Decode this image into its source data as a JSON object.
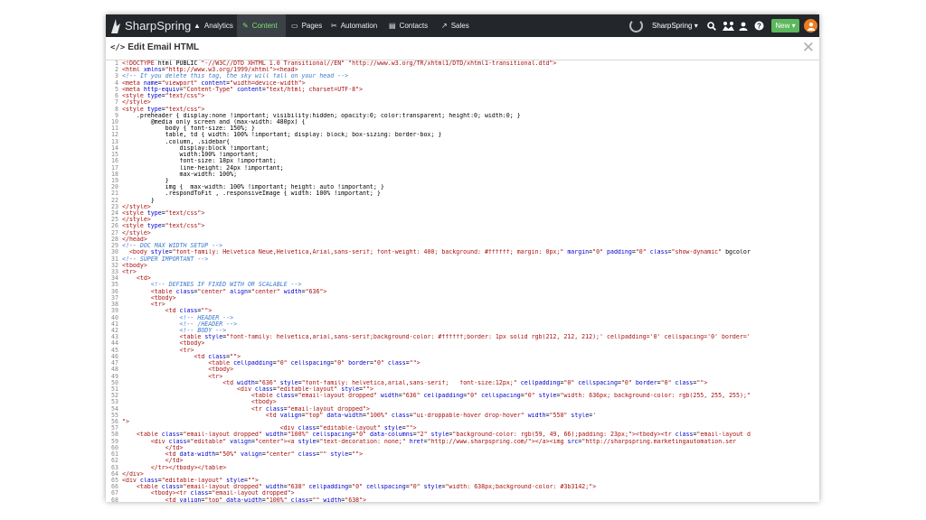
{
  "app": {
    "name": "SharpSpring"
  },
  "nav": {
    "items": [
      {
        "label": "Analytics",
        "icon": "analytics-icon",
        "glyph": "▲",
        "active": false
      },
      {
        "label": "Content",
        "icon": "pencil-icon",
        "glyph": "✎",
        "active": true
      },
      {
        "label": "Pages",
        "icon": "page-icon",
        "glyph": "▭",
        "active": false
      },
      {
        "label": "Automation",
        "icon": "automation-icon",
        "glyph": "✂",
        "active": false
      },
      {
        "label": "Contacts",
        "icon": "contacts-icon",
        "glyph": "▤",
        "active": false
      },
      {
        "label": "Sales",
        "icon": "sales-icon",
        "glyph": "↗",
        "active": false
      }
    ],
    "account_label": "SharpSpring ▾",
    "new_label": "New ▾",
    "right_icons": [
      "spinner-icon",
      "search-icon",
      "apps-icon",
      "user-icon",
      "help-icon",
      "avatar-icon"
    ]
  },
  "colors": {
    "topbar": "#23262b",
    "active_nav": "#3c4047",
    "active_text": "#7ee06e",
    "new_button": "#5cb85c",
    "avatar": "#f07c1e"
  },
  "header": {
    "title": "Edit Email HTML",
    "title_icon": "code-icon",
    "close_label": "✕",
    "close_icon": "close-icon"
  },
  "editor": {
    "lines": [
      "<!DOCTYPE html PUBLIC \"-//W3C//DTD XHTML 1.0 Transitional//EN\" \"http://www.w3.org/TR/xhtml1/DTD/xhtml1-transitional.dtd\">",
      "<html xmlns=\"http://www.w3.org/1999/xhtml\"><head>",
      "<!-- If you delete this tag, the sky will fall on your head -->",
      "<meta name=\"viewport\" content=\"width=device-width\">",
      "<meta http-equiv=\"Content-Type\" content=\"text/html; charset=UTF-8\">",
      "<style type=\"text/css\">",
      "</style>",
      "<style type=\"text/css\">",
      "    .preheader { display:none !important; visibility:hidden; opacity:0; color:transparent; height:0; width:0; }",
      "        @media only screen and (max-width: 480px) {",
      "            body { font-size: 150%; }",
      "            table, td { width: 100% !important; display: block; box-sizing: border-box; }",
      "            .column, .sidebar{",
      "                display:block !important;",
      "                width:100% !important;",
      "                font-size: 18px !important;",
      "                line-height: 24px !important;",
      "                max-width: 100%;",
      "            }",
      "            img {  max-width: 100% !important; height: auto !important; }",
      "            .respondToFit , .responsiveImage { width: 100% !important; }",
      "        }",
      "</style>",
      "<style type=\"text/css\">",
      "</style>",
      "<style type=\"text/css\">",
      "</style>",
      "</head>",
      "<!-- DOC MAX WIDTH SETUP -->",
      "  <body style=\"font-family: Helvetica Neue,Helvetica,Arial,sans-serif; font-weight: 400; background: #ffffff; margin: 0px;\" margin=\"0\" padding=\"0\" class=\"show-dynamic\" bgcolor",
      "<!-- SUPER IMPORTANT -->",
      "<tbody>",
      "<tr>",
      "    <td>",
      "        <!-- DEFINES IF FIXED WITH OR SCALABLE -->",
      "        <table class=\"center\" align=\"center\" width=\"636\">",
      "        <tbody>",
      "        <tr>",
      "            <td class=\"\">",
      "                <!-- HEADER -->",
      "                <!-- /HEADER -->",
      "                <!-- BODY -->",
      "                <table style=\"font-family: helvetica,arial,sans-serif;background-color: #ffffff;border: 1px solid rgb(212, 212, 212);' cellpadding='0' cellspacing='0' border='",
      "                <tbody>",
      "                <tr>",
      "                    <td class=\"\">",
      "                        <table cellpadding=\"0\" cellspacing=\"0\" border=\"0\" class=\"\">",
      "                        <tbody>",
      "                        <tr>",
      "                            <td width=\"636\" style=\"font-family: helvetica,arial,sans-serif;   font-size:12px;\" cellpadding=\"0\" cellspacing=\"0\" border=\"0\" class=\"\">",
      "                                <div class=\"editable-layout\" style=\"\">",
      "                                    <table class=\"email-layout dropped\" width=\"636\" cellpadding=\"0\" cellspacing=\"0\" style=\"width: 636px; background-color: rgb(255, 255, 255);\"",
      "                                    <tbody>",
      "                                    <tr class=\"email-layout dropped\">",
      "                                        <td valign=\"top\" data-width=\"100%\" class=\"ui-droppable-hover drop-hover\" width=\"550\" style='",
      "\">",
      "                                            <div class=\"editable-layout\" style=\"\">",
      "    <table class=\"email-layout dropped\" width=\"100%\" cellspacing=\"0\" data-columns=\"2\" style=\"background-color: rgb(59, 49, 66);padding: 23px;\"><tbody><tr class=\"email-layout d",
      "        <div class=\"editable\" valign=\"center\"><a style=\"text-decoration: none;\" href=\"http://www.sharpspring.com/\"></a><img src=\"http://sharpspring.marketingautomation.ser",
      "            </td>",
      "            <td data-width=\"50%\" valign=\"center\" class=\"\" style=\"\">",
      "            </td>",
      "        </tr></tbody></table>",
      "</div>",
      "<div class=\"editable-layout\" style=\"\">",
      "    <table class=\"email-layout dropped\" width=\"638\" cellpadding=\"0\" cellspacing=\"0\" style=\"width: 638px;background-color: #3b3142;\">",
      "        <tbody><tr class=\"email-layout dropped\">",
      "            <td valign=\"top\" data-width=\"100%\" class=\"\" width=\"638\">"
    ]
  }
}
